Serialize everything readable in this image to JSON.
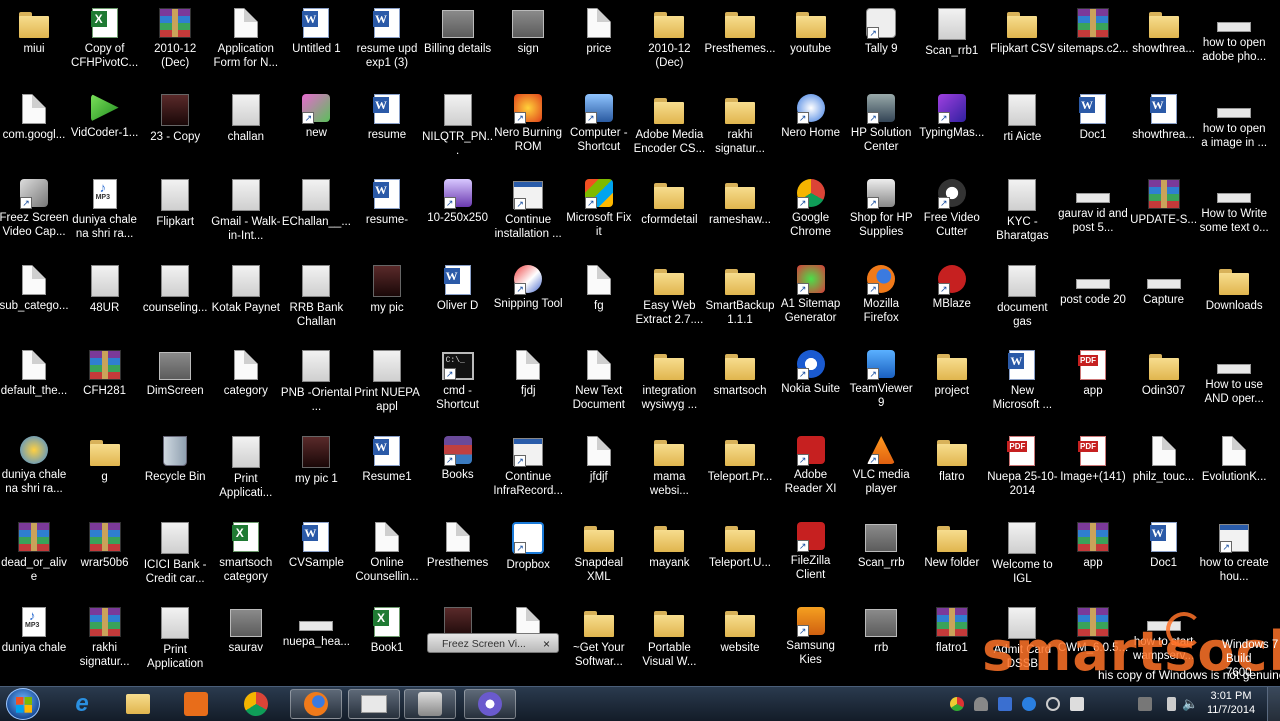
{
  "desktop": {
    "columns": [
      [
        {
          "label": "miui",
          "icon": "folder"
        },
        {
          "label": "com.googl...",
          "icon": "doc"
        },
        {
          "label": "Freez Screen Video Cap...",
          "icon": "app-freez"
        },
        {
          "label": "sub_catego...",
          "icon": "doc"
        },
        {
          "label": "default_the...",
          "icon": "doc"
        },
        {
          "label": "duniya chale na shri ra...",
          "icon": "wmp"
        },
        {
          "label": "dead_or_alive",
          "icon": "rar"
        },
        {
          "label": "duniya chale",
          "icon": "mp3"
        }
      ],
      [
        {
          "label": "Copy of CFHPivotC...",
          "icon": "excel"
        },
        {
          "label": "VidCoder-1...",
          "icon": "vidcoder"
        },
        {
          "label": "duniya chale na shri ra...",
          "icon": "mp3"
        },
        {
          "label": "48UR",
          "icon": "imglight"
        },
        {
          "label": "CFH281",
          "icon": "rar"
        },
        {
          "label": "g",
          "icon": "folder-g"
        },
        {
          "label": "wrar50b6",
          "icon": "rar"
        },
        {
          "label": "rakhi signatur...",
          "icon": "rar"
        }
      ],
      [
        {
          "label": "2010-12 (Dec)",
          "icon": "rar"
        },
        {
          "label": "23 - Copy",
          "icon": "imgdark"
        },
        {
          "label": "Flipkart",
          "icon": "imglight"
        },
        {
          "label": "counseling...",
          "icon": "imglight"
        },
        {
          "label": "DimScreen",
          "icon": "img"
        },
        {
          "label": "Recycle Bin",
          "icon": "bin"
        },
        {
          "label": "ICICI Bank - Credit car...",
          "icon": "imglight"
        },
        {
          "label": "Print Application",
          "icon": "imglight"
        }
      ],
      [
        {
          "label": "Application Form for N...",
          "icon": "doc"
        },
        {
          "label": "challan",
          "icon": "imglight"
        },
        {
          "label": "Gmail - Walk-in-Int...",
          "icon": "imglight"
        },
        {
          "label": "Kotak Paynet",
          "icon": "imglight"
        },
        {
          "label": "category",
          "icon": "doc"
        },
        {
          "label": "Print Applicati...",
          "icon": "imglight"
        },
        {
          "label": "smartsoch category",
          "icon": "excel"
        },
        {
          "label": "saurav",
          "icon": "img"
        }
      ],
      [
        {
          "label": "Untitled 1",
          "icon": "word"
        },
        {
          "label": "new",
          "icon": "app-new"
        },
        {
          "label": "EChallan__...",
          "icon": "imglight"
        },
        {
          "label": "RRB Bank Challan",
          "icon": "imglight"
        },
        {
          "label": "PNB -Oriental ...",
          "icon": "imglight"
        },
        {
          "label": "my pic 1",
          "icon": "imgdark"
        },
        {
          "label": "CVSample",
          "icon": "word"
        },
        {
          "label": "nuepa_hea...",
          "icon": "long"
        }
      ],
      [
        {
          "label": "resume upd exp1 (3)",
          "icon": "word"
        },
        {
          "label": "resume",
          "icon": "word"
        },
        {
          "label": "resume-",
          "icon": "word"
        },
        {
          "label": "my pic",
          "icon": "imgdark"
        },
        {
          "label": "Print NUEPA appl",
          "icon": "imglight"
        },
        {
          "label": "Resume1",
          "icon": "word"
        },
        {
          "label": "Online Counsellin...",
          "icon": "doc"
        },
        {
          "label": "Book1",
          "icon": "excel"
        }
      ],
      [
        {
          "label": "Billing details",
          "icon": "img"
        },
        {
          "label": "NILQTR_PN...",
          "icon": "imglight"
        },
        {
          "label": "10-250x250",
          "icon": "app-purple"
        },
        {
          "label": "Oliver D",
          "icon": "word"
        },
        {
          "label": "cmd - Shortcut",
          "icon": "cmd"
        },
        {
          "label": "Books",
          "icon": "app-books"
        },
        {
          "label": "Presthemes",
          "icon": "doc"
        },
        {
          "label": "",
          "icon": "imgdark"
        }
      ],
      [
        {
          "label": "sign",
          "icon": "img"
        },
        {
          "label": "Nero Burning ROM",
          "icon": "app-nero"
        },
        {
          "label": "Continue installation ...",
          "icon": "exe"
        },
        {
          "label": "Snipping Tool",
          "icon": "app-snip"
        },
        {
          "label": "fjdj",
          "icon": "doc"
        },
        {
          "label": "Continue InfraRecord...",
          "icon": "exe"
        },
        {
          "label": "Dropbox",
          "icon": "app-dropbox"
        },
        {
          "label": "",
          "icon": "doc"
        }
      ],
      [
        {
          "label": "price",
          "icon": "doc"
        },
        {
          "label": "Computer - Shortcut",
          "icon": "app-computer"
        },
        {
          "label": "Microsoft Fix it",
          "icon": "app-fixit"
        },
        {
          "label": "fg",
          "icon": "doc"
        },
        {
          "label": "New Text Document",
          "icon": "doc"
        },
        {
          "label": "jfdjf",
          "icon": "doc"
        },
        {
          "label": "Snapdeal XML",
          "icon": "folder"
        },
        {
          "label": "~Get Your Softwar...",
          "icon": "folder"
        }
      ],
      [
        {
          "label": "2010-12 (Dec)",
          "icon": "folder"
        },
        {
          "label": "Adobe Media Encoder CS...",
          "icon": "folder"
        },
        {
          "label": "cformdetail",
          "icon": "folder"
        },
        {
          "label": "Easy Web Extract 2.7....",
          "icon": "folder"
        },
        {
          "label": "integration wysiwyg ...",
          "icon": "folder"
        },
        {
          "label": "mama websi...",
          "icon": "folder"
        },
        {
          "label": "mayank",
          "icon": "folder"
        },
        {
          "label": "Portable Visual W...",
          "icon": "folder"
        }
      ],
      [
        {
          "label": "Presthemes...",
          "icon": "folder"
        },
        {
          "label": "rakhi signatur...",
          "icon": "folder"
        },
        {
          "label": "rameshaw...",
          "icon": "folder"
        },
        {
          "label": "SmartBackup 1.1.1",
          "icon": "folder"
        },
        {
          "label": "smartsoch",
          "icon": "folder"
        },
        {
          "label": "Teleport.Pr...",
          "icon": "folder"
        },
        {
          "label": "Teleport.U...",
          "icon": "folder"
        },
        {
          "label": "website",
          "icon": "folder"
        }
      ],
      [
        {
          "label": "youtube",
          "icon": "folder"
        },
        {
          "label": "Nero Home",
          "icon": "app-nerohome"
        },
        {
          "label": "Google Chrome",
          "icon": "app-chrome"
        },
        {
          "label": "A1 Sitemap Generator",
          "icon": "app-a1"
        },
        {
          "label": "Nokia Suite",
          "icon": "app-nokia"
        },
        {
          "label": "Adobe Reader XI",
          "icon": "app-adobe"
        },
        {
          "label": "FileZilla Client",
          "icon": "app-filezilla"
        },
        {
          "label": "Samsung Kies",
          "icon": "app-kies"
        }
      ],
      [
        {
          "label": "Tally 9",
          "icon": "app-tally"
        },
        {
          "label": "HP Solution Center",
          "icon": "app-hp"
        },
        {
          "label": "Shop for HP Supplies",
          "icon": "app-hpshop"
        },
        {
          "label": "Mozilla Firefox",
          "icon": "app-firefox"
        },
        {
          "label": "TeamViewer 9",
          "icon": "app-teamviewer"
        },
        {
          "label": "VLC media player",
          "icon": "app-vlc"
        },
        {
          "label": "Scan_rrb",
          "icon": "img"
        },
        {
          "label": "rrb",
          "icon": "img"
        }
      ],
      [
        {
          "label": "Scan_rrb1",
          "icon": "imglight"
        },
        {
          "label": "TypingMas...",
          "icon": "app-typing"
        },
        {
          "label": "Free Video Cutter",
          "icon": "app-cutter"
        },
        {
          "label": "MBlaze",
          "icon": "app-mblaze"
        },
        {
          "label": "project",
          "icon": "folder"
        },
        {
          "label": "flatro",
          "icon": "folder"
        },
        {
          "label": "New folder",
          "icon": "folder"
        },
        {
          "label": "flatro1",
          "icon": "rar"
        }
      ],
      [
        {
          "label": "Flipkart CSV",
          "icon": "folder"
        },
        {
          "label": "rti Aicte",
          "icon": "imglight"
        },
        {
          "label": "KYC - Bharatgas",
          "icon": "imglight"
        },
        {
          "label": "document gas",
          "icon": "imglight"
        },
        {
          "label": "New Microsoft ...",
          "icon": "word"
        },
        {
          "label": "Nuepa 25-10-2014",
          "icon": "pdf"
        },
        {
          "label": "Welcome to IGL",
          "icon": "imglight"
        },
        {
          "label": "Admit Card DSSB",
          "icon": "imglight"
        }
      ],
      [
        {
          "label": "sitemaps.c2...",
          "icon": "rar"
        },
        {
          "label": "Doc1",
          "icon": "word"
        },
        {
          "label": "gaurav id and post 5...",
          "icon": "long"
        },
        {
          "label": "post code 20",
          "icon": "long"
        },
        {
          "label": "app",
          "icon": "pdf"
        },
        {
          "label": "Image+(141)",
          "icon": "pdf"
        },
        {
          "label": "app",
          "icon": "rar"
        },
        {
          "label": "CWM_6.0.5...",
          "icon": "rar"
        }
      ],
      [
        {
          "label": "showthrea...",
          "icon": "folder"
        },
        {
          "label": "showthrea...",
          "icon": "word"
        },
        {
          "label": "UPDATE-S...",
          "icon": "rar"
        },
        {
          "label": "Capture",
          "icon": "long"
        },
        {
          "label": "Odin307",
          "icon": "folder"
        },
        {
          "label": "philz_touc...",
          "icon": "doc"
        },
        {
          "label": "Doc1",
          "icon": "word"
        },
        {
          "label": "how to start wampserv...",
          "icon": "long"
        }
      ],
      [
        {
          "label": "how to open adobe pho...",
          "icon": "long"
        },
        {
          "label": "how to open a image in ...",
          "icon": "long"
        },
        {
          "label": "How to Write some text o...",
          "icon": "long"
        },
        {
          "label": "Downloads",
          "icon": "folder"
        },
        {
          "label": "How to use AND oper...",
          "icon": "long"
        },
        {
          "label": "EvolutionK...",
          "icon": "doc"
        },
        {
          "label": "how to create hou...",
          "icon": "exe"
        },
        {
          "label": "",
          "icon": "none"
        }
      ]
    ]
  },
  "popup": {
    "title": "Freez Screen Vi...",
    "close": "×"
  },
  "watermark": {
    "os_line1": "Windows 7",
    "os_line2": "Build 7600",
    "notice": "his copy of Windows is not genuine",
    "brand": "smartsoch"
  },
  "clock": {
    "time": "3:01 PM",
    "date": "11/7/2014"
  },
  "taskbar": {
    "items": [
      {
        "name": "internet-explorer",
        "icon": "e",
        "color": "#2a8fe0"
      },
      {
        "name": "windows-explorer",
        "icon": "folder",
        "color": "#e8c05a"
      },
      {
        "name": "media-player",
        "icon": "▶",
        "color": "#e86d1a"
      },
      {
        "name": "chrome",
        "icon": "chrome",
        "color": "#e0c020"
      },
      {
        "name": "firefox",
        "icon": "firefox",
        "color": "#e0601a"
      },
      {
        "name": "window",
        "icon": "win",
        "color": "#d8d8d8"
      },
      {
        "name": "camera",
        "icon": "cam",
        "color": "#c0c0c0"
      },
      {
        "name": "app",
        "icon": "arc",
        "color": "#6a5acd"
      }
    ]
  }
}
